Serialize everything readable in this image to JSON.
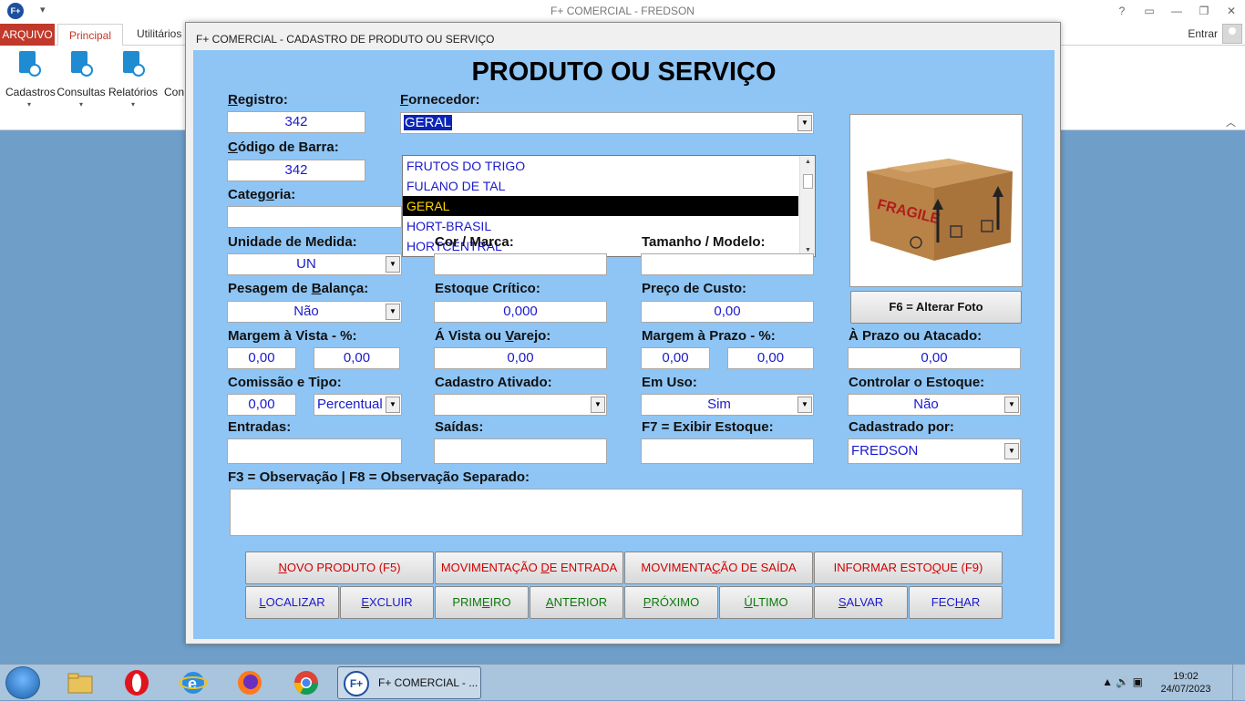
{
  "app": {
    "title": "F+ COMERCIAL - FREDSON",
    "logo": "F+",
    "tabs": {
      "arquivo": "ARQUIVO",
      "principal": "Principal",
      "utilitarios": "Utilitários"
    },
    "entrar": "Entrar",
    "ribbon": [
      {
        "label": "Cadastros",
        "icon": "cadastros-icon"
      },
      {
        "label": "Consultas",
        "icon": "consultas-icon"
      },
      {
        "label": "Relatórios",
        "icon": "relatorios-icon"
      },
      {
        "label": "Con"
      }
    ]
  },
  "dialog": {
    "title": "F+ COMERCIAL - CADASTRO DE PRODUTO OU SERVIÇO",
    "heading": "PRODUTO OU SERVIÇO",
    "registro": {
      "label": "Registro:",
      "value": "342"
    },
    "codigo_barra": {
      "label": "Código de Barra:",
      "value": "342"
    },
    "categoria": {
      "label": "Categoria:",
      "value": ""
    },
    "fornecedor": {
      "label": "Fornecedor:",
      "value": "GERAL",
      "options": [
        "FRUTOS DO TRIGO",
        "FULANO DE TAL",
        "GERAL",
        "HORT-BRASIL",
        "HORTCENTRAL"
      ],
      "selected_index": 2
    },
    "unidade_medida": {
      "label": "Unidade de Medida:",
      "value": "UN"
    },
    "cor_marca": {
      "label": "Cor / Marca:",
      "value": ""
    },
    "tamanho_modelo": {
      "label": "Tamanho / Modelo:",
      "value": ""
    },
    "pesagem_balanca": {
      "label": "Pesagem de Balança:",
      "value": "Não"
    },
    "estoque_critico": {
      "label": "Estoque Crítico:",
      "value": "0,000"
    },
    "preco_custo": {
      "label": "Preço de Custo:",
      "value": "0,00"
    },
    "margem_vista": {
      "label": "Margem à Vista - %:",
      "value1": "0,00",
      "value2": "0,00"
    },
    "vista_varejo": {
      "label": "Á Vista ou Varejo:",
      "value": "0,00"
    },
    "margem_prazo": {
      "label": "Margem à Prazo - %:",
      "value1": "0,00",
      "value2": "0,00"
    },
    "prazo_atacado": {
      "label": "À Prazo ou Atacado:",
      "value": "0,00"
    },
    "comissao_tipo": {
      "label": "Comissão e Tipo:",
      "value": "0,00",
      "tipo": "Percentual"
    },
    "cadastro_ativado": {
      "label": "Cadastro Ativado:",
      "value": ""
    },
    "em_uso": {
      "label": "Em Uso:",
      "value": "Sim"
    },
    "controlar_estoque": {
      "label": "Controlar o Estoque:",
      "value": "Não"
    },
    "entradas": {
      "label": "Entradas:",
      "value": ""
    },
    "saidas": {
      "label": "Saídas:",
      "value": ""
    },
    "exibir_estoque": {
      "label": "F7 = Exibir Estoque:",
      "value": ""
    },
    "cadastrado_por": {
      "label": "Cadastrado por:",
      "value": "FREDSON"
    },
    "observacao": {
      "label": "F3 = Observação | F8 = Observação Separado:",
      "value": ""
    },
    "photo": {
      "icon": "product-box-icon",
      "text": "FRAGILE"
    },
    "buttons": {
      "alterar_foto": "F6 = Alterar Foto",
      "novo_produto": "NOVO PRODUTO (F5)",
      "mov_entrada": "MOVIMENTAÇÃO DE ENTRADA",
      "mov_saida": "MOVIMENTAÇÃO DE SAÍDA",
      "informar_estoque": "INFORMAR ESTOQUE (F9)",
      "localizar": "LOCALIZAR",
      "excluir": "EXCLUIR",
      "primeiro": "PRIMEIRO",
      "anterior": "ANTERIOR",
      "proximo": "PRÓXIMO",
      "ultimo": "ÚLTIMO",
      "salvar": "SALVAR",
      "fechar": "FECHAR"
    }
  },
  "taskbar": {
    "active_window": "F+ COMERCIAL - ...",
    "time": "19:02",
    "date": "24/07/2023"
  },
  "colors": {
    "form_bg": "#8ec5f5",
    "field_text": "#1a1acc",
    "button_red": "#d10000",
    "button_green": "#0a7a0a"
  }
}
